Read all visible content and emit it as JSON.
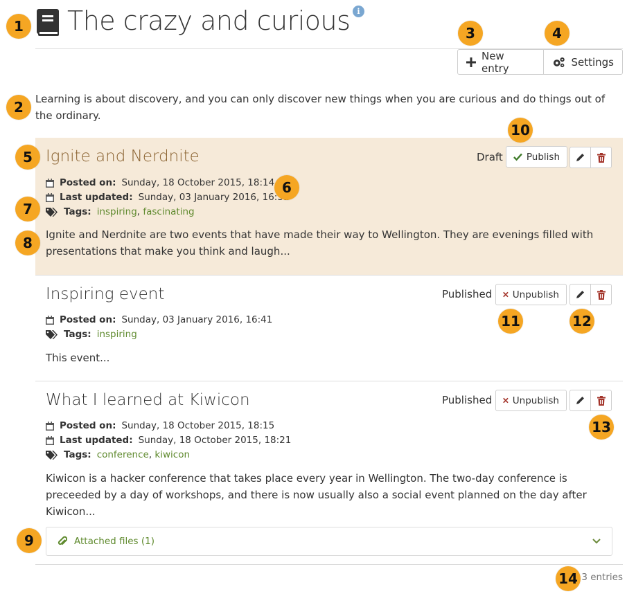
{
  "page": {
    "title": "The crazy and curious",
    "intro": "Learning is about discovery, and you can only discover new things when you are curious and do things out of the ordinary.",
    "entries_count": "3 entries"
  },
  "toolbar": {
    "new_entry_label": "New entry",
    "settings_label": "Settings"
  },
  "labels": {
    "posted_on": "Posted on:",
    "last_updated": "Last updated:",
    "tags": "Tags:",
    "publish": "Publish",
    "unpublish": "Unpublish"
  },
  "entries": [
    {
      "title": "Ignite and Nerdnite",
      "status": "Draft",
      "posted_on": "Sunday, 18 October 2015, 18:14",
      "last_updated": "Sunday, 03 January 2016, 16:31",
      "tags": [
        "inspiring",
        "fascinating"
      ],
      "body": "Ignite and Nerdnite are two events that have made their way to Wellington. They are evenings filled with presentations that make you think and laugh..."
    },
    {
      "title": "Inspiring event",
      "status": "Published",
      "posted_on": "Sunday, 03 January 2016, 16:41",
      "tags": [
        "inspiring"
      ],
      "body": "This event..."
    },
    {
      "title": "What I learned at Kiwicon",
      "status": "Published",
      "posted_on": "Sunday, 18 October 2015, 18:15",
      "last_updated": "Sunday, 18 October 2015, 18:21",
      "tags": [
        "conference",
        "kiwicon"
      ],
      "body": "Kiwicon is a hacker conference that takes place every year in Wellington. The two-day conference is preceeded by a day of workshops, and there is now usually also a social event planned on the day after Kiwicon...",
      "attached_files": "Attached files (1)"
    }
  ],
  "callouts": [
    "1",
    "2",
    "3",
    "4",
    "5",
    "6",
    "7",
    "8",
    "9",
    "10",
    "11",
    "12",
    "13",
    "14"
  ],
  "icons": {
    "title": "book-icon",
    "info": "info-icon",
    "new_entry": "plus-icon",
    "settings": "gears-icon",
    "calendar": "calendar-icon",
    "tags": "tags-icon",
    "publish": "check-icon",
    "unpublish": "times-icon",
    "edit": "pencil-icon",
    "delete": "trash-icon",
    "attachment": "paperclip-icon",
    "expand": "chevron-down-icon"
  },
  "colors": {
    "callout": "#f5a623",
    "draft_background": "#f6ead9",
    "draft_title": "#8a6230",
    "tag_link": "#5f8a2e",
    "delete_icon": "#a3342a",
    "publish_check": "#3d7a28",
    "unpublish_x": "#a3342a"
  }
}
